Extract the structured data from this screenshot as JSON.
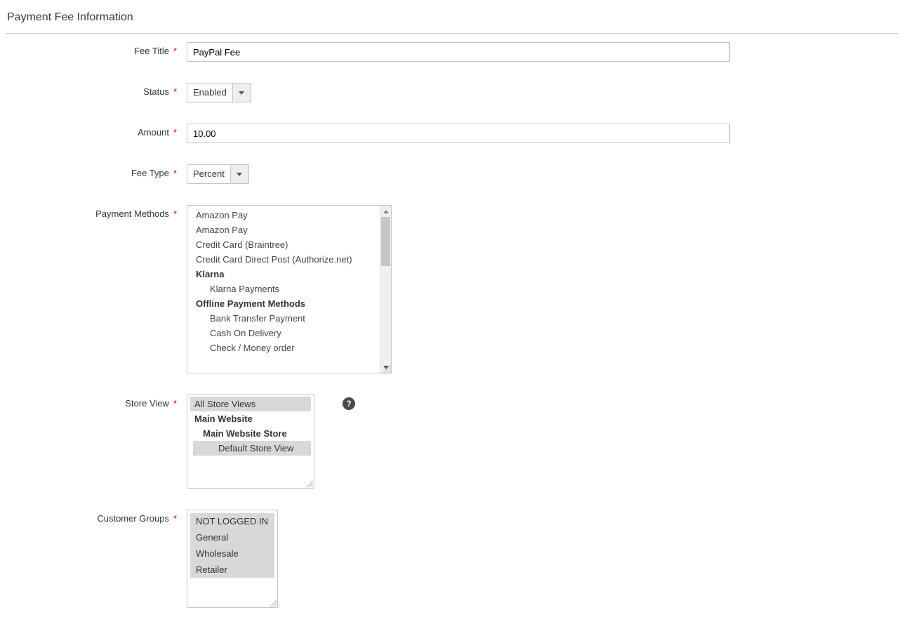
{
  "section": {
    "title": "Payment Fee Information"
  },
  "fields": {
    "fee_title": {
      "label": "Fee Title",
      "value": "PayPal Fee"
    },
    "status": {
      "label": "Status",
      "value": "Enabled"
    },
    "amount": {
      "label": "Amount",
      "value": "10.00"
    },
    "fee_type": {
      "label": "Fee Type",
      "value": "Percent"
    },
    "payment_methods": {
      "label": "Payment Methods",
      "items": [
        {
          "type": "item",
          "label": "Amazon Pay"
        },
        {
          "type": "item",
          "label": "Amazon Pay"
        },
        {
          "type": "item",
          "label": "Credit Card (Braintree)"
        },
        {
          "type": "item",
          "label": "Credit Card Direct Post (Authorize.net)"
        },
        {
          "type": "group",
          "label": "Klarna"
        },
        {
          "type": "item",
          "label": "Klarna Payments",
          "indent": 1
        },
        {
          "type": "group",
          "label": "Offline Payment Methods"
        },
        {
          "type": "item",
          "label": "Bank Transfer Payment",
          "indent": 1
        },
        {
          "type": "item",
          "label": "Cash On Delivery",
          "indent": 1
        },
        {
          "type": "item",
          "label": "Check / Money order",
          "indent": 1
        }
      ]
    },
    "store_view": {
      "label": "Store View",
      "items": [
        {
          "type": "item",
          "label": "All Store Views",
          "selected": true
        },
        {
          "type": "group",
          "label": "Main Website"
        },
        {
          "type": "subgroup",
          "label": "Main Website Store"
        },
        {
          "type": "child",
          "label": "Default Store View",
          "selected": true
        }
      ]
    },
    "customer_groups": {
      "label": "Customer Groups",
      "items": [
        {
          "label": "NOT LOGGED IN"
        },
        {
          "label": "General"
        },
        {
          "label": "Wholesale"
        },
        {
          "label": "Retailer"
        }
      ]
    }
  },
  "help_glyph": "?"
}
